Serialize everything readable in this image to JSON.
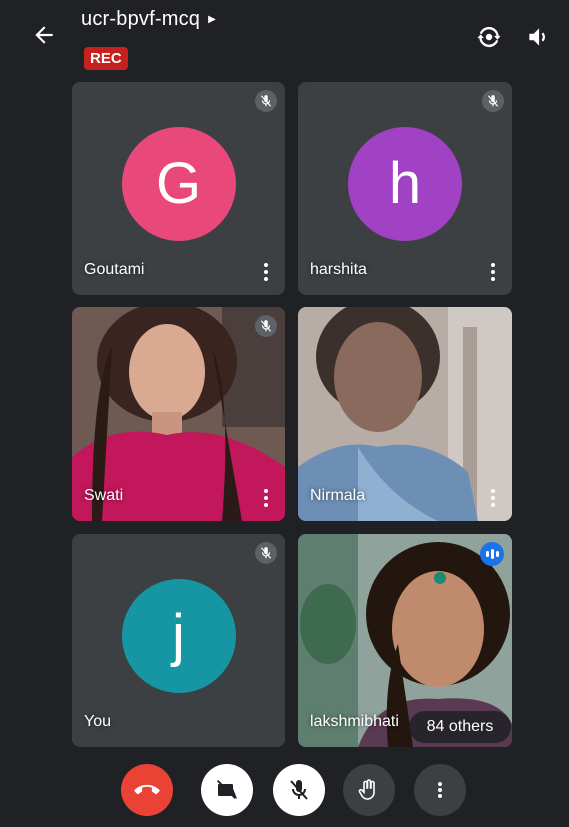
{
  "header": {
    "meeting_code": "ucr-bpvf-mcq",
    "rec_label": "REC",
    "icons": [
      "back-arrow-icon",
      "switch-camera-icon",
      "speaker-icon"
    ]
  },
  "participants": [
    {
      "name": "Goutami",
      "avatar_letter": "G",
      "avatar_color": "#e8487a",
      "muted": true
    },
    {
      "name": "harshita",
      "avatar_letter": "h",
      "avatar_color": "#a142c4",
      "muted": true
    },
    {
      "name": "Swati",
      "video": true,
      "muted": true
    },
    {
      "name": "Nirmala",
      "video": true,
      "muted": false
    },
    {
      "name": "You",
      "avatar_letter": "j",
      "avatar_color": "#1696a2",
      "muted": true
    },
    {
      "name": "lakshmibhati",
      "video": true,
      "speaking": true
    }
  ],
  "others_chip": "84 others",
  "controls": {
    "icons": [
      "end-call-icon",
      "camera-off-icon",
      "mic-off-icon",
      "raise-hand-icon",
      "more-options-icon"
    ]
  },
  "colors": {
    "background": "#202124",
    "tile": "#3c4043",
    "end_call": "#ea4335",
    "rec": "#c5221f",
    "speaking": "#1a73e8"
  }
}
